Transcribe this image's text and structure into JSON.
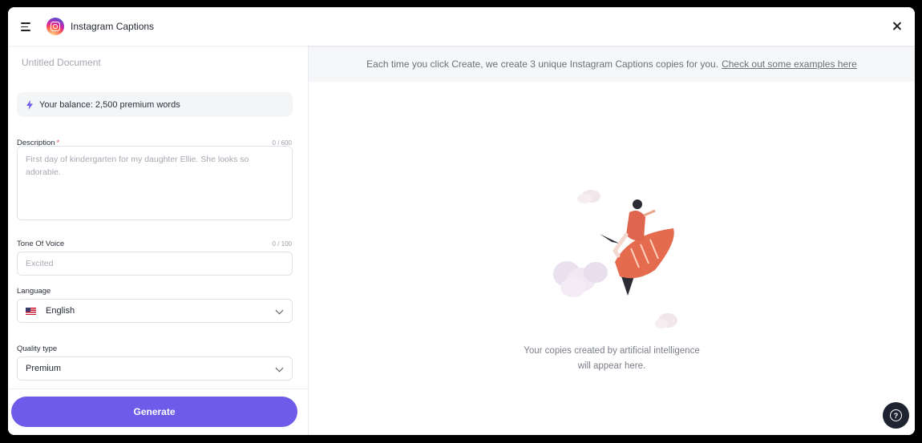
{
  "header": {
    "title": "Instagram Captions",
    "menu_icon": "hamburger-menu-icon",
    "logo_icon": "instagram-logo-icon",
    "close_icon": "close-icon"
  },
  "form": {
    "document_title": "Untitled Document",
    "balance_text": "Your balance: 2,500 premium words",
    "description": {
      "label": "Description",
      "required_mark": "*",
      "counter": "0 / 600",
      "placeholder": "First day of kindergarten for my daughter Ellie. She looks so adorable."
    },
    "tone": {
      "label": "Tone Of Voice",
      "counter": "0 / 100",
      "placeholder": "Excited"
    },
    "language": {
      "label": "Language",
      "value": "English",
      "flag": "us-flag-icon"
    },
    "quality": {
      "label": "Quality type",
      "value": "Premium"
    },
    "generate_label": "Generate"
  },
  "output": {
    "info_text": "Each time you click Create, we create 3 unique Instagram Captions copies for you.",
    "info_link": "Check out some examples here",
    "empty_line1": "Your copies created by artificial intelligence",
    "empty_line2": "will appear here.",
    "help_icon": "help-question-icon"
  },
  "colors": {
    "accent": "#6f5be9",
    "required": "#e5484d",
    "help_button": "#1d2330"
  }
}
